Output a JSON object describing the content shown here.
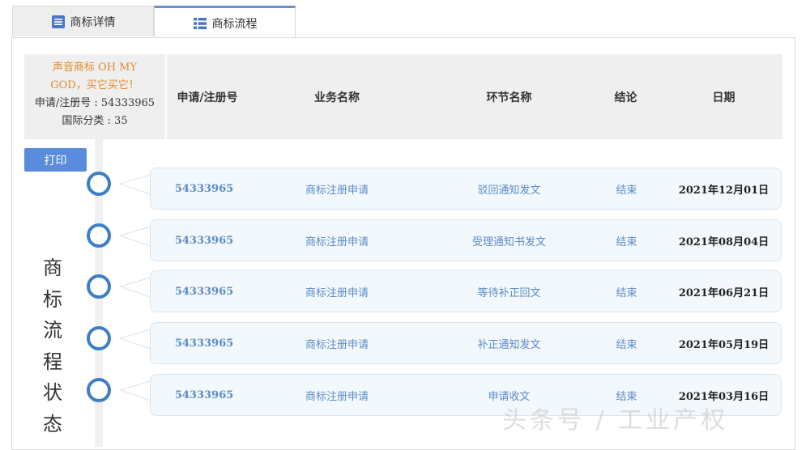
{
  "tabs": [
    {
      "label": "商标详情",
      "icon": "document-list-icon"
    },
    {
      "label": "商标流程",
      "icon": "list-icon"
    }
  ],
  "info": {
    "name": "声音商标 OH MY GOD，买它买它！",
    "reg_line": "申请/注册号 : 54333965",
    "class_line": "国际分类 : 35"
  },
  "headers": [
    "申请/注册号",
    "业务名称",
    "环节名称",
    "结论",
    "日期"
  ],
  "print_label": "打印",
  "vertical_title": [
    "商",
    "标",
    "流",
    "程",
    "状",
    "态"
  ],
  "rows": [
    {
      "number": "54333965",
      "business": "商标注册申请",
      "step": "驳回通知发文",
      "result": "结束",
      "date": "2021年12月01日"
    },
    {
      "number": "54333965",
      "business": "商标注册申请",
      "step": "受理通知书发文",
      "result": "结束",
      "date": "2021年08月04日"
    },
    {
      "number": "54333965",
      "business": "商标注册申请",
      "step": "等待补正回文",
      "result": "结束",
      "date": "2021年06月21日"
    },
    {
      "number": "54333965",
      "business": "商标注册申请",
      "step": "补正通知发文",
      "result": "结束",
      "date": "2021年05月19日"
    },
    {
      "number": "54333965",
      "business": "商标注册申请",
      "step": "申请收文",
      "result": "结束",
      "date": "2021年03月16日"
    }
  ],
  "watermark": "头条号 / 工业产权"
}
